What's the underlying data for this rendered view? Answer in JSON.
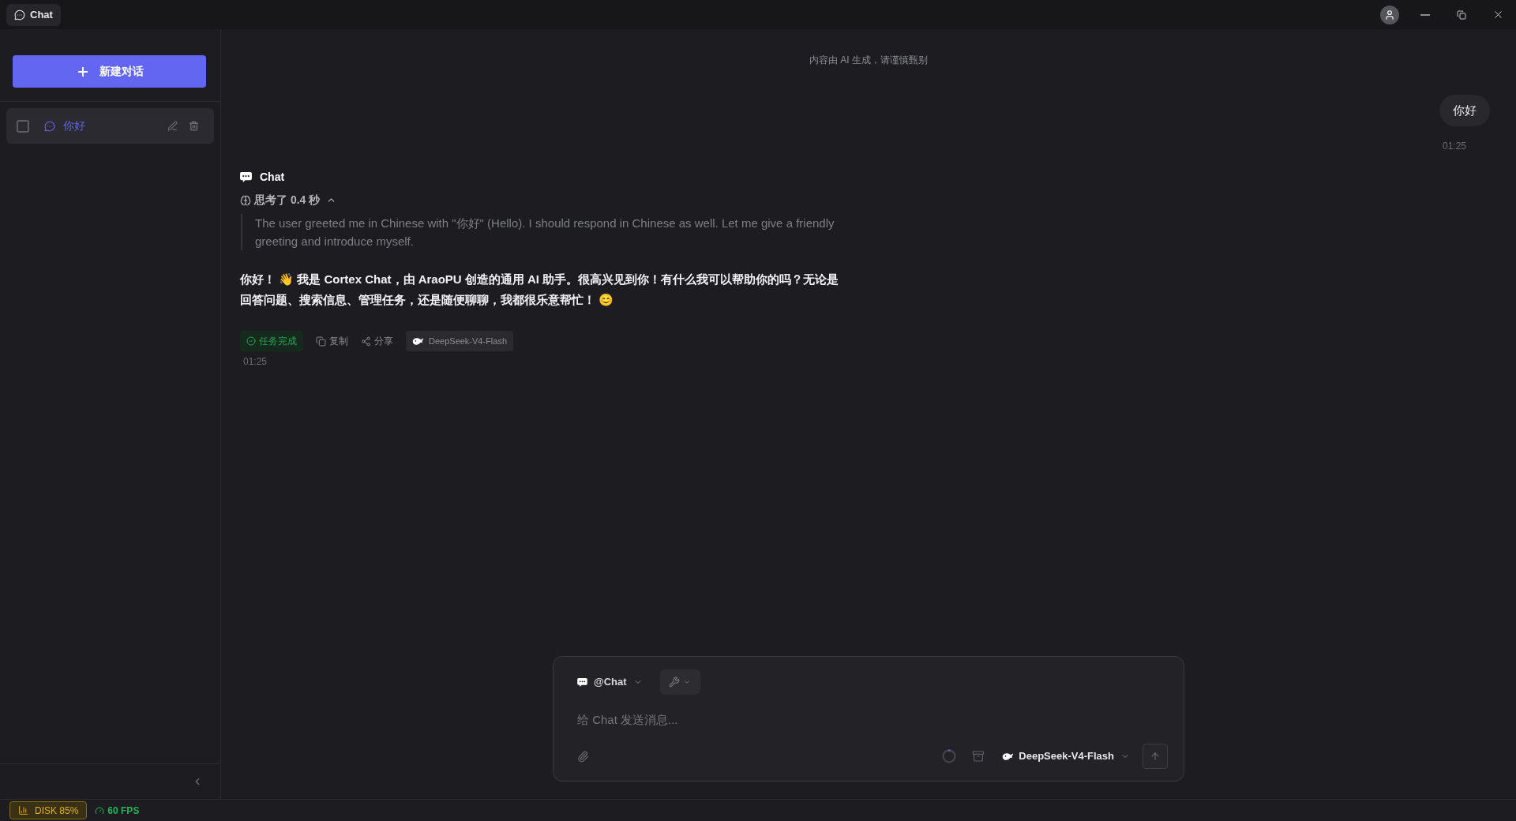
{
  "window": {
    "tab": "Chat"
  },
  "sidebar": {
    "new_chat_button": "新建对话",
    "conversations": [
      {
        "title": "你好",
        "checked": false,
        "selected": true
      }
    ]
  },
  "notice": "内容由 AI 生成，请谨慎甄别",
  "messages": [
    {
      "kind": "user",
      "text": "你好",
      "time": "01:25"
    },
    {
      "kind": "assistant",
      "agent": "Chat",
      "thinking": {
        "label": "思考了 0.4 秒",
        "expanded": true,
        "text": "The user greeted me in Chinese with \"你好\" (Hello). I should respond in Chinese as well. Let me give a friendly greeting and introduce myself."
      },
      "answer": "你好！ 👋 我是 Cortex Chat，由 AraoPU 创造的通用 AI 助手。很高兴见到你！有什么我可以帮助你的吗？无论是回答问题、搜索信息、管理任务，还是随便聊聊，我都很乐意帮忙！ 😊",
      "status": "任务完成",
      "actions": [
        {
          "kind": "copy",
          "label": "复制"
        },
        {
          "kind": "share",
          "label": "分享"
        }
      ],
      "model": "DeepSeek-V4-Flash",
      "time": "01:25"
    }
  ],
  "composer": {
    "agent": "@Chat",
    "placeholder": "给 Chat 发送消息...",
    "model": "DeepSeek-V4-Flash"
  },
  "status_bar": {
    "disk": "DISK 85%",
    "fps": "60 FPS"
  }
}
